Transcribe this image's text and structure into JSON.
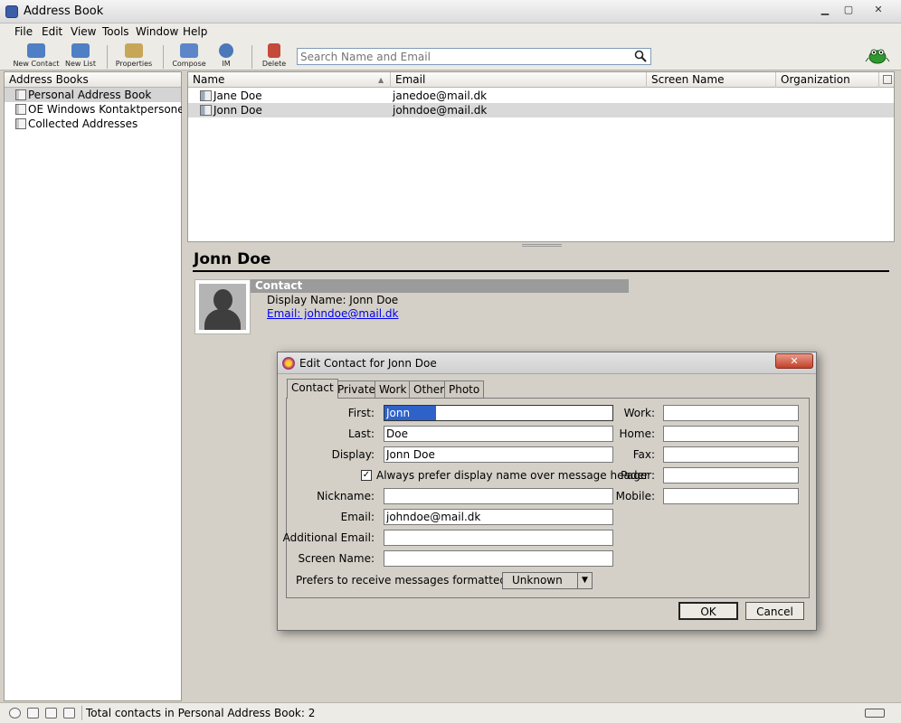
{
  "window": {
    "title": "Address Book"
  },
  "menu": [
    "File",
    "Edit",
    "View",
    "Tools",
    "Window",
    "Help"
  ],
  "toolbar": {
    "new_contact": "New Contact",
    "new_list": "New List",
    "properties": "Properties",
    "compose": "Compose",
    "im": "IM",
    "delete": "Delete",
    "search_placeholder": "Search Name and Email"
  },
  "address_books": {
    "header": "Address Books",
    "items": [
      "Personal Address Book",
      "OE Windows Kontaktpersoner",
      "Collected Addresses"
    ]
  },
  "contact_list": {
    "columns": [
      "Name",
      "Email",
      "Screen Name",
      "Organization"
    ],
    "rows": [
      {
        "name": "Jane Doe",
        "email": "janedoe@mail.dk"
      },
      {
        "name": "Jonn Doe",
        "email": "johndoe@mail.dk"
      }
    ]
  },
  "card": {
    "name": "Jonn Doe",
    "section": "Contact",
    "display": "Display Name: Jonn Doe",
    "email": "Email: johndoe@mail.dk"
  },
  "status": {
    "text": "Total contacts in Personal Address Book: 2"
  },
  "dialog": {
    "title": "Edit Contact for Jonn Doe",
    "tabs": [
      "Contact",
      "Private",
      "Work",
      "Other",
      "Photo"
    ],
    "labels": {
      "first": "First:",
      "last": "Last:",
      "display": "Display:",
      "prefer": "Always prefer display name over message header",
      "nickname": "Nickname:",
      "email": "Email:",
      "additional_email": "Additional Email:",
      "screen_name": "Screen Name:",
      "format": "Prefers to receive messages formatted as:",
      "work": "Work:",
      "home": "Home:",
      "fax": "Fax:",
      "pager": "Pager:",
      "mobile": "Mobile:"
    },
    "values": {
      "first": "Jonn",
      "last": "Doe",
      "display": "Jonn Doe",
      "nickname": "",
      "email": "johndoe@mail.dk",
      "additional_email": "",
      "screen_name": "",
      "work": "",
      "home": "",
      "fax": "",
      "pager": "",
      "mobile": "",
      "format": "Unknown",
      "prefer_checked": "✓"
    },
    "ok": "OK",
    "cancel": "Cancel"
  }
}
